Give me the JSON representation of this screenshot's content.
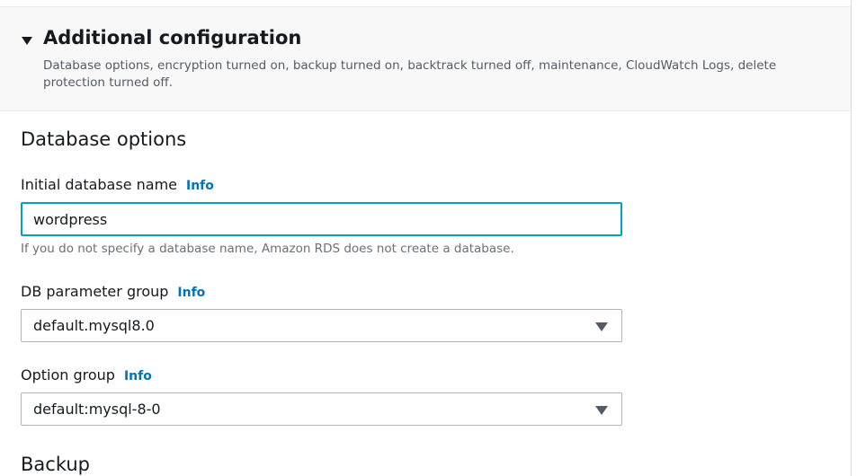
{
  "additional_config": {
    "title": "Additional configuration",
    "description": "Database options, encryption turned on, backup turned on, backtrack turned off, maintenance, CloudWatch Logs, delete protection turned off."
  },
  "database_options": {
    "section_title": "Database options",
    "initial_db_name": {
      "label": "Initial database name",
      "info": "Info",
      "value": "wordpress",
      "constraint": "If you do not specify a database name, Amazon RDS does not create a database."
    },
    "db_parameter_group": {
      "label": "DB parameter group",
      "info": "Info",
      "selected": "default.mysql8.0"
    },
    "option_group": {
      "label": "Option group",
      "info": "Info",
      "selected": "default:mysql-8-0"
    }
  },
  "backup": {
    "section_title": "Backup"
  },
  "icons": {
    "expand": "caret-down-icon",
    "dropdown": "caret-down-icon"
  },
  "colors": {
    "link": "#0073bb",
    "focus_border": "#00a1c9",
    "header_bg": "#f8f8f8"
  }
}
